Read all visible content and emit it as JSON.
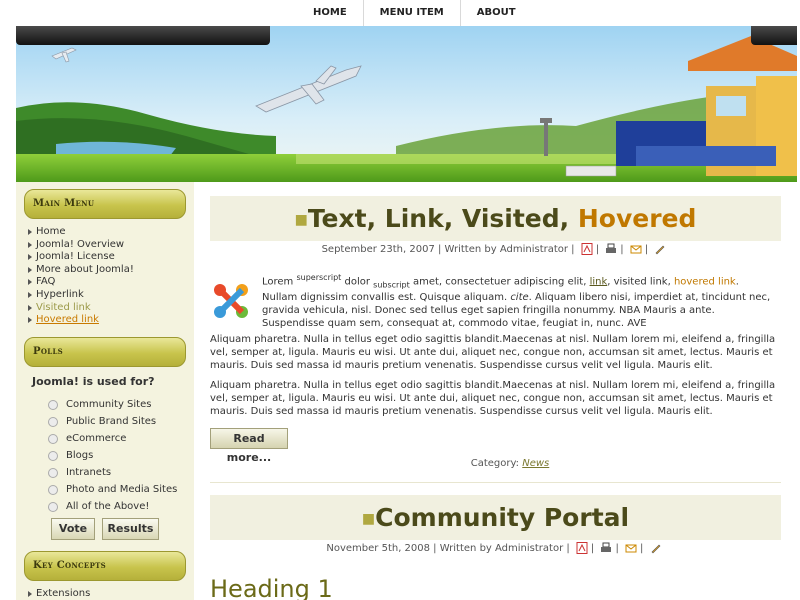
{
  "topnav": {
    "items": [
      "HOME",
      "MENU ITEM",
      "ABOUT"
    ]
  },
  "sidebar": {
    "main_menu": {
      "title": "Main Menu",
      "items": [
        "Home",
        "Joomla! Overview",
        "Joomla! License",
        "More about Joomla!",
        "FAQ",
        "Hyperlink",
        "Visited link",
        "Hovered link"
      ]
    },
    "polls": {
      "title": "Polls",
      "question": "Joomla! is used for?",
      "options": [
        "Community Sites",
        "Public Brand Sites",
        "eCommerce",
        "Blogs",
        "Intranets",
        "Photo and Media Sites",
        "All of the Above!"
      ],
      "vote_label": "Vote",
      "results_label": "Results"
    },
    "key_concepts": {
      "title": "Key Concepts",
      "items": [
        "Extensions"
      ]
    }
  },
  "article1": {
    "title_a": "Text, Link, Visited, ",
    "title_b": "Hovered",
    "meta": "September 23th, 2007 | Written by Administrator |",
    "p1_a": "Lorem ",
    "p1_sup": "superscript",
    "p1_b": " dolor ",
    "p1_sub": "subscript",
    "p1_c": " amet, consectetuer adipiscing elit, ",
    "p1_link": "link",
    "p1_d": ", visited link, ",
    "p1_hov": "hovered link",
    "p1_e": ". Nullam dignissim convallis est. Quisque aliquam. ",
    "p1_cite": "cite",
    "p1_f": ". Aliquam libero nisi, imperdiet at, tincidunt nec, gravida vehicula, nisl. Donec sed tellus eget sapien fringilla nonummy. NBA Mauris a ante. Suspendisse quam sem, consequat at, commodo vitae, feugiat in, nunc. AVE",
    "p2": "Aliquam pharetra. Nulla in tellus eget odio sagittis blandit.Maecenas at nisl. Nullam lorem mi, eleifend a, fringilla vel, semper at, ligula. Mauris eu wisi. Ut ante dui, aliquet nec, congue non, accumsan sit amet, lectus. Mauris et mauris. Duis sed massa id mauris pretium venenatis. Suspendisse cursus velit vel ligula. Mauris elit.",
    "p3": "Aliquam pharetra. Nulla in tellus eget odio sagittis blandit.Maecenas at nisl. Nullam lorem mi, eleifend a, fringilla vel, semper at, ligula. Mauris eu wisi. Ut ante dui, aliquet nec, congue non, accumsan sit amet, lectus. Mauris et mauris. Duis sed massa id mauris pretium venenatis. Suspendisse cursus velit vel ligula. Mauris elit.",
    "read_more": "Read more...",
    "category_label": "Category:",
    "category_value": "News"
  },
  "article2": {
    "title": "Community Portal",
    "meta": "November 5th, 2008 | Written by Administrator |"
  },
  "heading1": "Heading 1",
  "colors": {
    "accent": "#c07800",
    "sidebar_bg": "#f4f3df",
    "module_head": "#c8c44c"
  },
  "icons": [
    "pdf-icon",
    "print-icon",
    "email-icon",
    "edit-icon",
    "joomla-logo"
  ]
}
